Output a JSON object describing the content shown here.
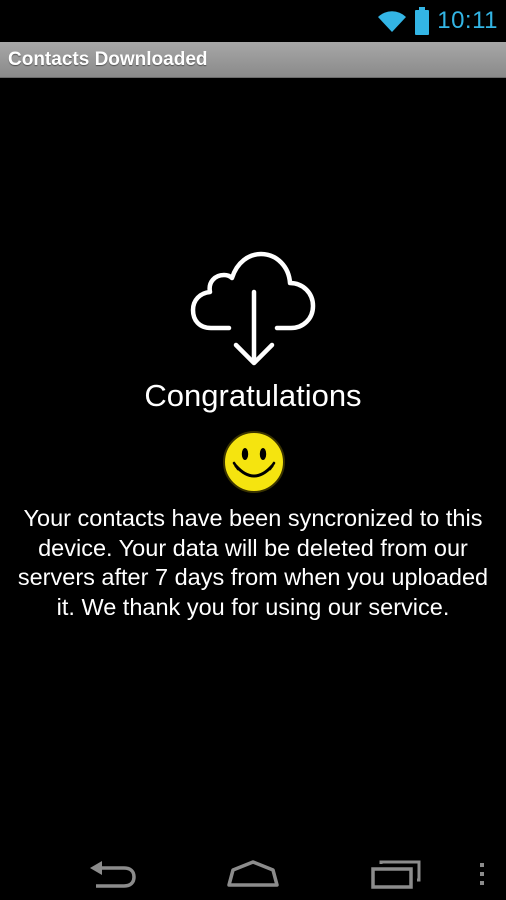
{
  "status_bar": {
    "time": "10:11",
    "accent_color": "#33b5e5",
    "icons": [
      "wifi-icon",
      "battery-icon"
    ]
  },
  "title_bar": {
    "title": "Contacts Downloaded"
  },
  "content": {
    "icon": "cloud-download-icon",
    "headline": "Congratulations",
    "emoji": "smiley-face-icon",
    "message": "Your contacts have been syncronized to this device. Your data will be deleted from our servers after 7 days from when you uploaded it. We thank you for using our service."
  },
  "nav_bar": {
    "buttons": [
      "back-icon",
      "home-icon",
      "recent-apps-icon",
      "menu-icon"
    ]
  }
}
